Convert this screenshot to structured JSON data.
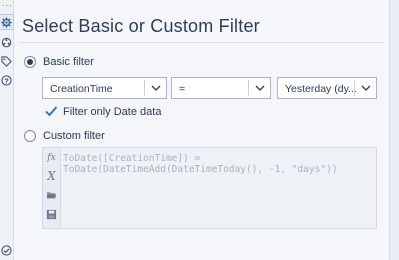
{
  "window": {
    "title": "Select Basic or Custom Filter"
  },
  "rail": {
    "dots": "...",
    "icons": [
      "gear-icon",
      "network-icon",
      "tag-icon",
      "help-icon"
    ],
    "bottom_icon": "check-circle-icon"
  },
  "basic": {
    "label": "Basic filter",
    "selected": true,
    "field": {
      "value": "CreationTime"
    },
    "operator": {
      "value": "="
    },
    "date_value": {
      "value": "Yesterday (dy..."
    },
    "date_only": {
      "label": "Filter only Date data",
      "checked": true
    }
  },
  "custom": {
    "label": "Custom filter",
    "selected": false,
    "expression_line1": "ToDate([CreationTime]) =",
    "expression_line2": "ToDate(DateTimeAdd(DateTimeToday(), -1, \"days\"))",
    "gutter_icons": [
      "fx-icon",
      "variable-x-icon",
      "open-folder-icon",
      "save-icon"
    ]
  },
  "colors": {
    "accent": "#2f6db5",
    "text": "#2b3b55",
    "panel": "#f4f6fa"
  }
}
